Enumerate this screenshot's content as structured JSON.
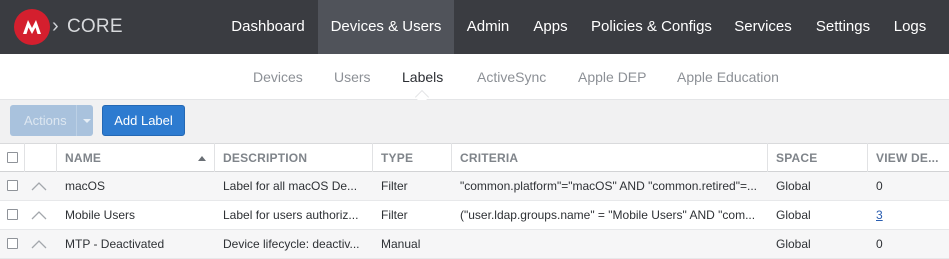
{
  "brand": {
    "chevron": "›",
    "name": "CORE",
    "logo_icon": "mobileiron-logo"
  },
  "nav": [
    {
      "label": "Dashboard",
      "active": false
    },
    {
      "label": "Devices & Users",
      "active": true
    },
    {
      "label": "Admin",
      "active": false
    },
    {
      "label": "Apps",
      "active": false
    },
    {
      "label": "Policies & Configs",
      "active": false
    },
    {
      "label": "Services",
      "active": false
    },
    {
      "label": "Settings",
      "active": false
    },
    {
      "label": "Logs",
      "active": false
    }
  ],
  "subnav": [
    {
      "label": "Devices",
      "active": false
    },
    {
      "label": "Users",
      "active": false
    },
    {
      "label": "Labels",
      "active": true
    },
    {
      "label": "ActiveSync",
      "active": false
    },
    {
      "label": "Apple DEP",
      "active": false
    },
    {
      "label": "Apple Education",
      "active": false
    }
  ],
  "toolbar": {
    "actions_label": "Actions",
    "add_label": "Add Label"
  },
  "table": {
    "columns": [
      "NAME",
      "DESCRIPTION",
      "TYPE",
      "CRITERIA",
      "SPACE",
      "VIEW DE..."
    ],
    "sorted_column": "NAME",
    "sort_direction": "ascending",
    "rows": [
      {
        "name": "macOS",
        "description": "Label for all macOS De...",
        "type": "Filter",
        "criteria": "\"common.platform\"=\"macOS\" AND \"common.retired\"=...",
        "space": "Global",
        "view": "0",
        "view_is_link": false
      },
      {
        "name": "Mobile Users",
        "description": "Label for users authoriz...",
        "type": "Filter",
        "criteria": "(\"user.ldap.groups.name\" = \"Mobile Users\" AND \"com...",
        "space": "Global",
        "view": "3",
        "view_is_link": true
      },
      {
        "name": "MTP - Deactivated",
        "description": "Device lifecycle: deactiv...",
        "type": "Manual",
        "criteria": "",
        "space": "Global",
        "view": "0",
        "view_is_link": false
      }
    ]
  },
  "colors": {
    "topbar": "#3a3c41",
    "active_nav": "#50535a",
    "brand_red": "#d41f2e",
    "primary_button": "#2d7bd0",
    "disabled_button": "#a9c2dd",
    "link": "#2a5db0"
  }
}
